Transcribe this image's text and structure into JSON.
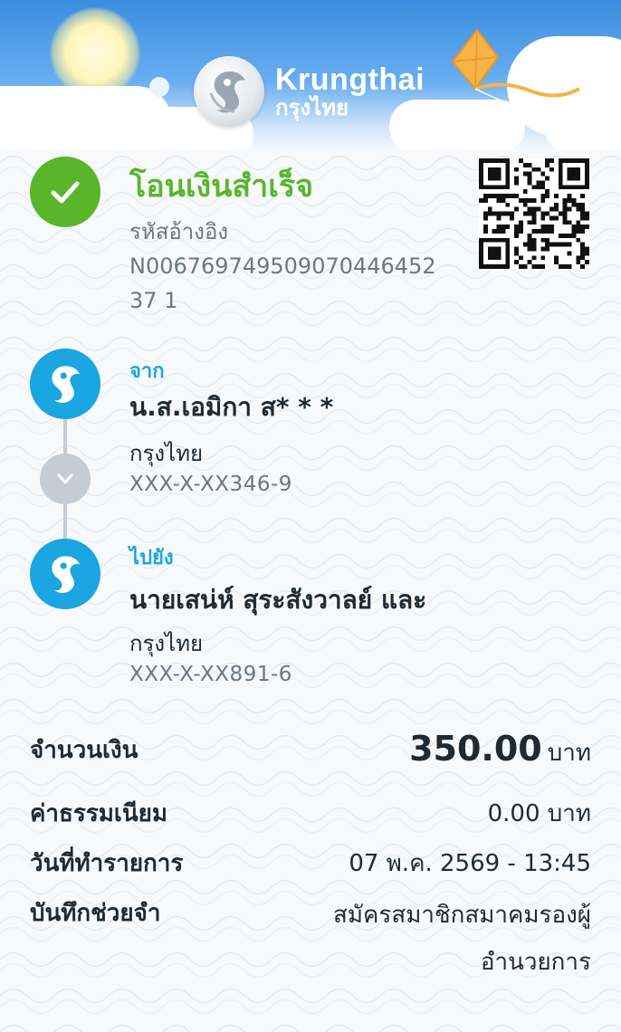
{
  "header": {
    "logo_en": "Krungthai",
    "logo_th": "กรุงไทย"
  },
  "status": {
    "title": "โอนเงินสำเร็จ",
    "ref_label": "รหัสอ้างอิง",
    "ref_value": "N00676974950907044645237 1"
  },
  "from": {
    "label": "จาก",
    "name": "น.ส.เอมิกา ส* * *",
    "bank": "กรุงไทย",
    "account": "XXX-X-XX346-9"
  },
  "to": {
    "label": "ไปยัง",
    "name": "นายเสน่ห์ สุระสังวาลย์ และ",
    "bank": "กรุงไทย",
    "account": "XXX-X-XX891-6"
  },
  "details": {
    "amount_label": "จำนวนเงิน",
    "amount_value": "350.00",
    "amount_unit": "บาท",
    "fee_label": "ค่าธรรมเนียม",
    "fee_value": "0.00 บาท",
    "date_label": "วันที่ทำรายการ",
    "date_value": "07 พ.ค. 2569 - 13:45",
    "memo_label": "บันทึกช่วยจำ",
    "memo_value": "สมัครสมาชิกสมาคมรองผู้อำนวยการ"
  },
  "colors": {
    "success_green": "#5ab52b",
    "krungthai_blue": "#1ba5e1",
    "muted_text": "#6c7780",
    "dark_text": "#1f2a33"
  },
  "icons": {
    "status": "checkmark-icon",
    "bank": "krungthai-logo-icon",
    "connector": "chevron-down-icon",
    "qr": "qr-code-icon"
  }
}
